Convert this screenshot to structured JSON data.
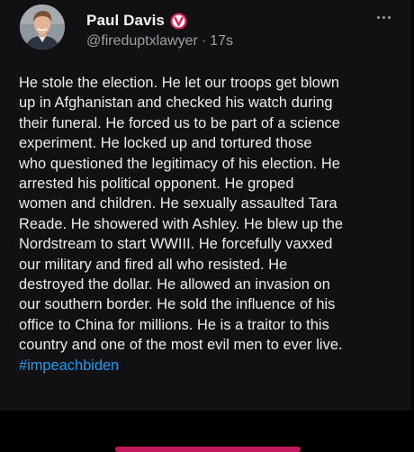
{
  "post": {
    "author": {
      "display_name": "Paul Davis",
      "handle": "@fireduptxlawyer",
      "separator": "·",
      "timestamp": "17s",
      "verified_badge_color": "#e0245e",
      "avatar_icon": "profile-photo"
    },
    "more_icon": "more-horizontal-icon",
    "lines": [
      "He stole the election. He let our troops get blown",
      "up in Afghanistan and checked his watch during",
      "their funeral. He forced us to be part of a science",
      "experiment. He locked up and tortured those",
      "who questioned the legitimacy of his election. He",
      "arrested his political opponent. He groped",
      "women and children. He sexually assaulted Tara",
      "Reade. He showered with Ashley. He blew up the",
      "Nordstream to start WWIII. He forcefully vaxxed",
      "our military and fired all who resisted. He",
      "destroyed the dollar. He allowed an invasion on",
      "our southern border. He sold the influence of his",
      "office to China for millions. He is a traitor to this",
      "country and one of the most evil men to ever live."
    ],
    "hashtag": "#impeachbiden",
    "colors": {
      "background": "#111113",
      "text": "#ececec",
      "secondary_text": "#9aa0a6",
      "link": "#1d9bf0"
    }
  }
}
